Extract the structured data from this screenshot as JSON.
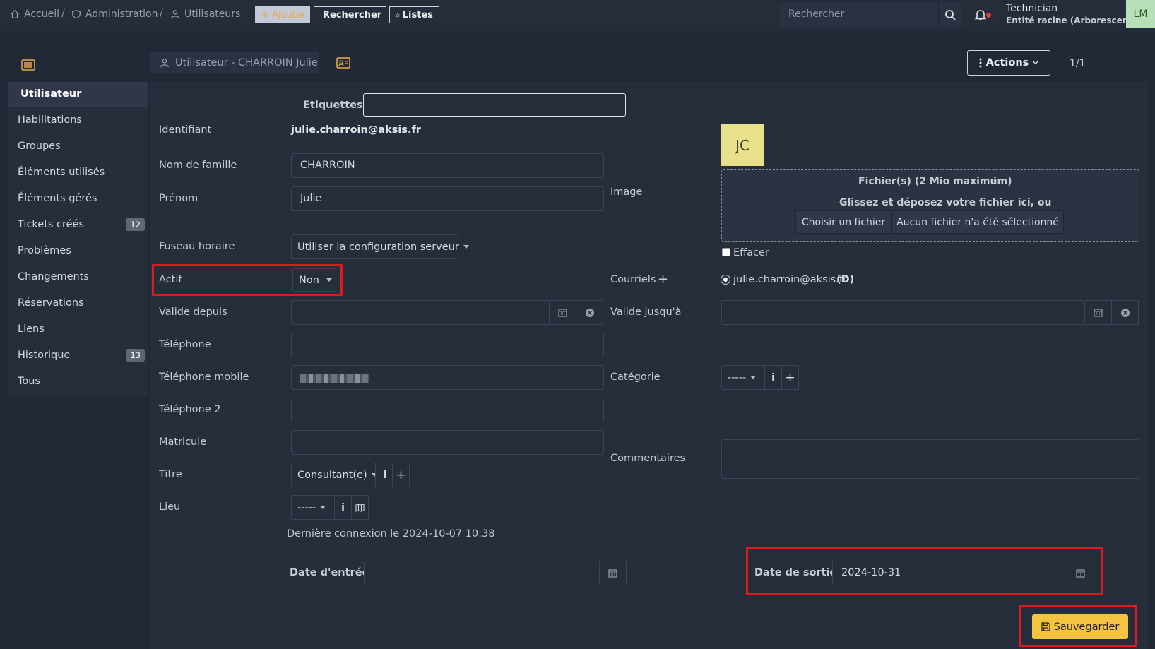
{
  "breadcrumb": {
    "home": "Accueil",
    "admin": "Administration",
    "users": "Utilisateurs",
    "sep": "/"
  },
  "toolbar": {
    "add": "+ Ajouter",
    "search": "Rechercher",
    "lists": "Listes"
  },
  "global_search": {
    "placeholder": "Rechercher"
  },
  "user_profile": {
    "profile": "Technician",
    "entity": "Entité racine (Arborescence)",
    "initials": "LM"
  },
  "tab": {
    "title": "Utilisateur - CHARROIN Julie"
  },
  "actions": {
    "label": "Actions",
    "pager": "1/1"
  },
  "sidebar": {
    "items": [
      {
        "label": "Utilisateur",
        "badge": ""
      },
      {
        "label": "Habilitations",
        "badge": ""
      },
      {
        "label": "Groupes",
        "badge": ""
      },
      {
        "label": "Éléments utilisés",
        "badge": ""
      },
      {
        "label": "Éléments gérés",
        "badge": ""
      },
      {
        "label": "Tickets créés",
        "badge": "12"
      },
      {
        "label": "Problèmes",
        "badge": ""
      },
      {
        "label": "Changements",
        "badge": ""
      },
      {
        "label": "Réservations",
        "badge": ""
      },
      {
        "label": "Liens",
        "badge": ""
      },
      {
        "label": "Historique",
        "badge": "13"
      },
      {
        "label": "Tous",
        "badge": ""
      }
    ]
  },
  "form": {
    "etiquettes_label": "Etiquettes",
    "identifiant_label": "Identifiant",
    "identifiant_value": "julie.charroin@aksis.fr",
    "nom_label": "Nom de famille",
    "nom_value": "CHARROIN",
    "prenom_label": "Prénom",
    "prenom_value": "Julie",
    "fuseau_label": "Fuseau horaire",
    "fuseau_value": "Utiliser la configuration serveur",
    "actif_label": "Actif",
    "actif_value": "Non",
    "valide_depuis_label": "Valide depuis",
    "telephone_label": "Téléphone",
    "mobile_label": "Téléphone mobile",
    "telephone2_label": "Téléphone 2",
    "matricule_label": "Matricule",
    "titre_label": "Titre",
    "titre_value": "Consultant(e)",
    "lieu_label": "Lieu",
    "lieu_value": "-----",
    "last_login": "Dernière connexion le 2024-10-07 10:38",
    "date_entree_label": "Date d'entrée",
    "image_label": "Image",
    "avatar_initials": "JC",
    "upload_title": "Fichier(s) (2 Mio maximum)",
    "upload_hint": "Glissez et déposez votre fichier ici, ou",
    "choose_file": "Choisir un fichier",
    "no_file": "Aucun fichier n'a été sélectionné",
    "effacer_label": "Effacer",
    "courriels_label": "Courriels",
    "email_value": "julie.charroin@aksis.fr",
    "email_default": "(D)",
    "valide_jusqua_label": "Valide jusqu'à",
    "categorie_label": "Catégorie",
    "categorie_value": "-----",
    "commentaires_label": "Commentaires",
    "date_sortie_label": "Date de sortie",
    "date_sortie_value": "2024-10-31",
    "save_label": "Sauvegarder"
  },
  "colors": {
    "accent": "#f5c342",
    "highlight": "#e0191e",
    "avatar_bg": "#e8e08a",
    "user_avatar_bg": "#b8e0b8"
  }
}
